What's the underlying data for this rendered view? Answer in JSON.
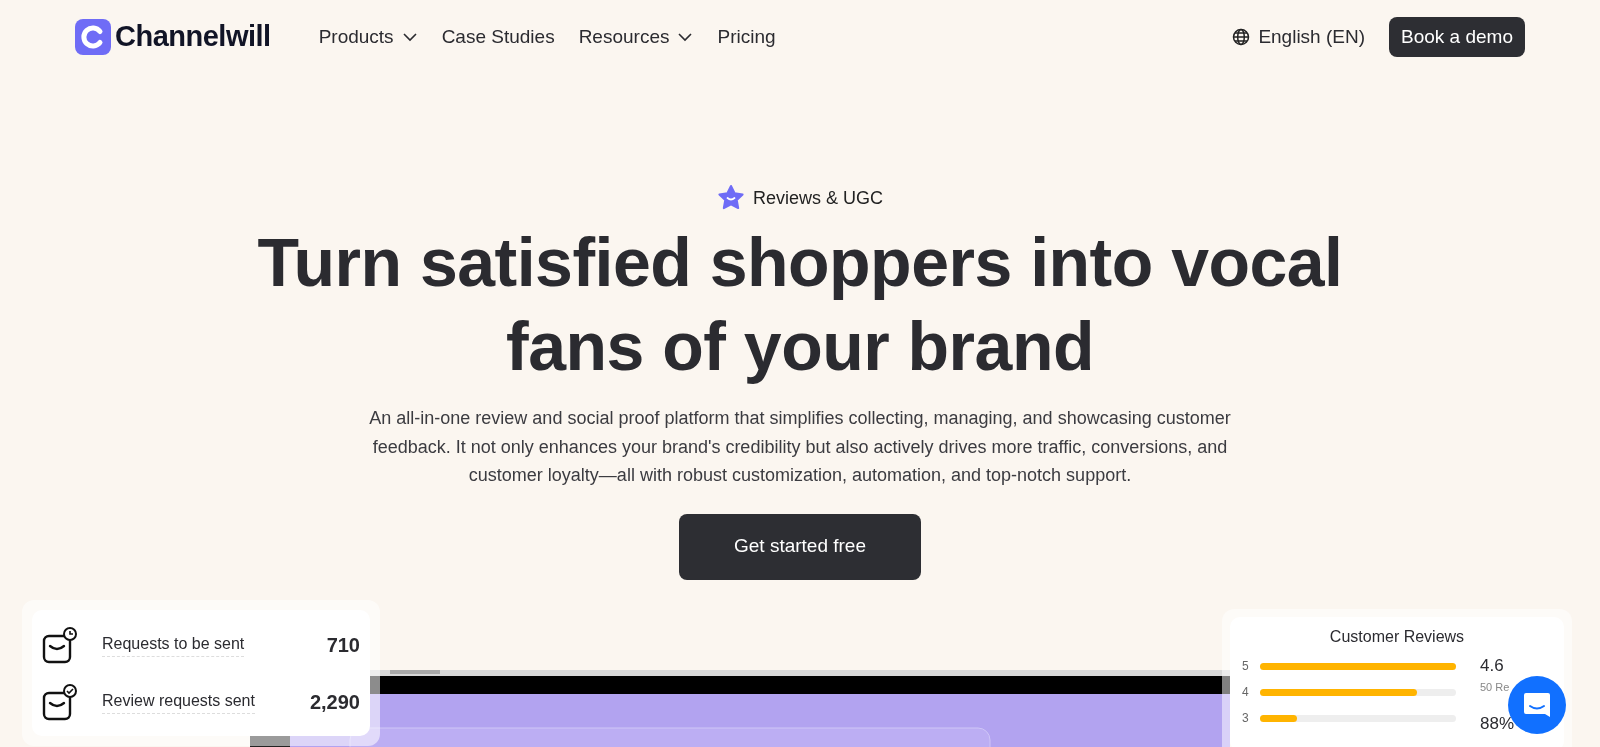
{
  "brand": {
    "name": "Channelwill"
  },
  "nav": [
    {
      "label": "Products",
      "dropdown": true
    },
    {
      "label": "Case Studies",
      "dropdown": false
    },
    {
      "label": "Resources",
      "dropdown": true
    },
    {
      "label": "Pricing",
      "dropdown": false
    }
  ],
  "language": "English (EN)",
  "cta_nav": "Book a demo",
  "hero": {
    "eyebrow": "Reviews & UGC",
    "title": "Turn satisfied shoppers into vocal fans of your brand",
    "description": "An all-in-one review and social proof platform that simplifies collecting, managing, and showcasing customer feedback. It not only enhances your brand's credibility but also actively drives more traffic, conversions, and customer loyalty—all with robust customization, automation, and top-notch support.",
    "button": "Get started free"
  },
  "stats": [
    {
      "kind": "pending",
      "label": "Requests to be sent",
      "value": "710"
    },
    {
      "kind": "sent",
      "label": "Review requests sent",
      "value": "2,290"
    }
  ],
  "reviews": {
    "title": "Customer Reviews",
    "rows": [
      {
        "label": "5",
        "level": 1.0
      },
      {
        "label": "4",
        "level": 0.8
      },
      {
        "label": "3",
        "level": 0.19
      }
    ],
    "rating": "4.6",
    "count": "50 Re",
    "percent": "88%"
  }
}
